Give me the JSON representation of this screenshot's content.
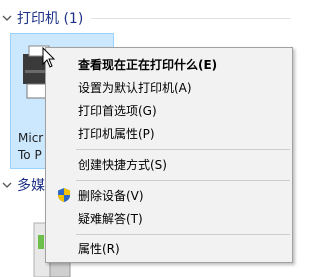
{
  "sections": {
    "printers": {
      "label": "打印机 (1)"
    },
    "multimedia": {
      "label": "多媒"
    }
  },
  "printer_tile": {
    "caption_line1": "Micr",
    "caption_line2": "To P"
  },
  "context_menu": {
    "items": [
      {
        "label": "查看现在正在打印什么(E)",
        "bold": true
      },
      {
        "label": "设置为默认打印机(A)"
      },
      {
        "label": "打印首选项(G)"
      },
      {
        "label": "打印机属性(P)"
      },
      {
        "label": "创建快捷方式(S)"
      },
      {
        "label": "删除设备(V)",
        "icon": "uac-shield-icon"
      },
      {
        "label": "疑难解答(T)"
      },
      {
        "label": "属性(R)"
      }
    ]
  },
  "colors": {
    "header_text": "#1e3287",
    "tile_selected_bg": "#cce8ff",
    "tile_selected_border": "#99d1ff",
    "menu_bg": "#f2f2f2",
    "menu_border": "#a0a0a0"
  }
}
